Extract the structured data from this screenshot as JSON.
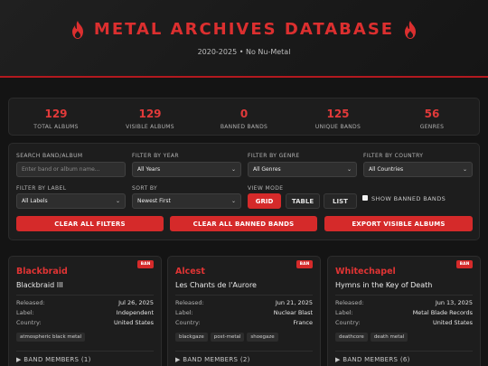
{
  "header": {
    "title": "METAL ARCHIVES DATABASE",
    "subtitle": "2020-2025 • No Nu-Metal",
    "icon": "flame-icon",
    "accent": "#dc2f2f"
  },
  "stats": [
    {
      "value": "129",
      "label": "TOTAL ALBUMS"
    },
    {
      "value": "129",
      "label": "VISIBLE ALBUMS"
    },
    {
      "value": "0",
      "label": "BANNED BANDS"
    },
    {
      "value": "125",
      "label": "UNIQUE BANDS"
    },
    {
      "value": "56",
      "label": "GENRES"
    }
  ],
  "filters": {
    "search_label": "SEARCH BAND/ALBUM",
    "search_placeholder": "Enter band or album name...",
    "year_label": "FILTER BY YEAR",
    "year_value": "All Years",
    "genre_label": "FILTER BY GENRE",
    "genre_value": "All Genres",
    "country_label": "FILTER BY COUNTRY",
    "country_value": "All Countries",
    "label_label": "FILTER BY LABEL",
    "label_value": "All Labels",
    "sort_label": "SORT BY",
    "sort_value": "Newest First",
    "view_label": "VIEW MODE",
    "view_grid": "GRID",
    "view_table": "TABLE",
    "view_list": "LIST",
    "show_banned": "SHOW BANNED BANDS",
    "clear_filters": "CLEAR ALL FILTERS",
    "clear_banned": "CLEAR ALL BANNED BANDS",
    "export": "EXPORT VISIBLE ALBUMS"
  },
  "cards": [
    {
      "band": "Blackbraid",
      "album": "Blackbraid III",
      "ban": "BAN",
      "released_label": "Released:",
      "released": "Jul 26, 2025",
      "label_label": "Label:",
      "label": "Independent",
      "country_label": "Country:",
      "country": "United States",
      "tags": [
        "atmospheric black metal"
      ],
      "members": "BAND MEMBERS (1)"
    },
    {
      "band": "Alcest",
      "album": "Les Chants de l'Aurore",
      "ban": "BAN",
      "released_label": "Released:",
      "released": "Jun 21, 2025",
      "label_label": "Label:",
      "label": "Nuclear Blast",
      "country_label": "Country:",
      "country": "France",
      "tags": [
        "blackgaze",
        "post-metal",
        "shoegaze"
      ],
      "members": "BAND MEMBERS (2)"
    },
    {
      "band": "Whitechapel",
      "album": "Hymns in the Key of Death",
      "ban": "BAN",
      "released_label": "Released:",
      "released": "Jun 13, 2025",
      "label_label": "Label:",
      "label": "Metal Blade Records",
      "country_label": "Country:",
      "country": "United States",
      "tags": [
        "deathcore",
        "death metal"
      ],
      "members": "BAND MEMBERS (6)"
    }
  ]
}
